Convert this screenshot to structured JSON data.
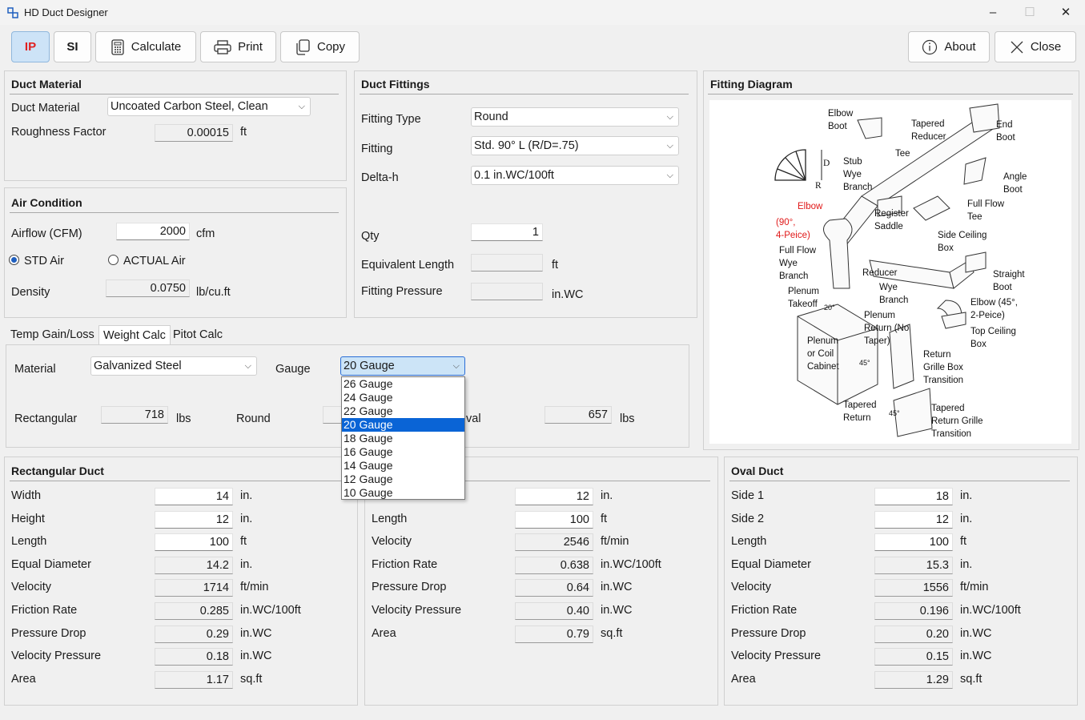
{
  "window": {
    "title": "HD Duct Designer",
    "min": "–",
    "max": "☐",
    "close": "✕"
  },
  "toolbar": {
    "ip": "IP",
    "si": "SI",
    "calculate": "Calculate",
    "print": "Print",
    "copy": "Copy",
    "about": "About",
    "close": "Close"
  },
  "duct_material": {
    "title": "Duct Material",
    "material_label": "Duct Material",
    "material_value": "Uncoated Carbon Steel, Clean",
    "roughness_label": "Roughness Factor",
    "roughness_value": "0.00015",
    "roughness_unit": "ft"
  },
  "air": {
    "title": "Air Condition",
    "airflow_label": "Airflow (CFM)",
    "airflow_value": "2000",
    "airflow_unit": "cfm",
    "std_label": "STD Air",
    "actual_label": "ACTUAL Air",
    "std_selected": true,
    "density_label": "Density",
    "density_value": "0.0750",
    "density_unit": "lb/cu.ft"
  },
  "fittings": {
    "title": "Duct Fittings",
    "type_label": "Fitting Type",
    "type_value": "Round",
    "fitting_label": "Fitting",
    "fitting_value": "Std. 90° L (R/D=.75)",
    "deltah_label": "Delta-h",
    "deltah_value": "0.1 in.WC/100ft",
    "qty_label": "Qty",
    "qty_value": "1",
    "eqlen_label": "Equivalent Length",
    "eqlen_value": "",
    "eqlen_unit": "ft",
    "press_label": "Fitting Pressure",
    "press_value": "",
    "press_unit": "in.WC"
  },
  "tabs": [
    "Temp Gain/Loss",
    "Weight Calc",
    "Pitot Calc"
  ],
  "active_tab": 1,
  "weight": {
    "material_label": "Material",
    "material_value": "Galvanized Steel",
    "gauge_label": "Gauge",
    "gauge_value": "20 Gauge",
    "gauge_options": [
      "26 Gauge",
      "24 Gauge",
      "22 Gauge",
      "20 Gauge",
      "18 Gauge",
      "16 Gauge",
      "14 Gauge",
      "12 Gauge",
      "10 Gauge"
    ],
    "gauge_selected_index": 3,
    "rect_label": "Rectangular",
    "rect_value": "718",
    "rect_unit": "lbs",
    "round_label": "Round",
    "oval_label": "Oval",
    "oval_label_visible": "val",
    "oval_value": "657",
    "oval_unit": "lbs"
  },
  "diagram": {
    "title": "Fitting Diagram",
    "labels": {
      "elbow_boot": [
        "Elbow",
        "Boot"
      ],
      "tapered_reducer": [
        "Tapered",
        "Reducer"
      ],
      "end_boot": [
        "End",
        "Boot"
      ],
      "tee": "Tee",
      "stub_wye": [
        "Stub",
        "Wye",
        "Branch"
      ],
      "angle_boot": [
        "Angle",
        "Boot"
      ],
      "elbow": "Elbow",
      "elbow_sub": [
        "(90°,",
        "4-Peice)"
      ],
      "full_flow_tee": [
        "Full Flow",
        "Tee"
      ],
      "register_saddle": [
        "Register",
        "Saddle"
      ],
      "side_ceiling_box": [
        "Side Ceiling",
        "Box"
      ],
      "full_flow_wye": [
        "Full Flow",
        "Wye",
        "Branch"
      ],
      "reducer_wye": [
        "Reducer",
        "Wye",
        "Branch"
      ],
      "straight_boot": [
        "Straight",
        "Boot"
      ],
      "plenum_takeoff": [
        "Plenum",
        "Takeoff"
      ],
      "elbow45": [
        "Elbow (45°,",
        "2-Peice)"
      ],
      "plenum_return": [
        "Plenum",
        "Return (No",
        "Taper)"
      ],
      "top_ceiling_box": [
        "Top Ceiling",
        "Box"
      ],
      "plenum_coil": [
        "Plenum",
        "or Coil",
        "Cabinet"
      ],
      "return_grille": [
        "Return",
        "Grille Box",
        "Transition"
      ],
      "tapered_return": [
        "Tapered",
        "Return"
      ],
      "tapered_return_grille": [
        "Tapered",
        "Return Grille",
        "Transition"
      ],
      "d": "D",
      "r": "R",
      "a20": "20°",
      "a45": "45°",
      "a45b": "45°"
    }
  },
  "rect": {
    "title": "Rectangular Duct",
    "rows": [
      {
        "label": "Width",
        "value": "14",
        "unit": "in.",
        "ro": false
      },
      {
        "label": "Height",
        "value": "12",
        "unit": "in.",
        "ro": false
      },
      {
        "label": "Length",
        "value": "100",
        "unit": "ft",
        "ro": false
      },
      {
        "label": "Equal Diameter",
        "value": "14.2",
        "unit": "in.",
        "ro": true
      },
      {
        "label": "Velocity",
        "value": "1714",
        "unit": "ft/min",
        "ro": true
      },
      {
        "label": "Friction Rate",
        "value": "0.285",
        "unit": "in.WC/100ft",
        "ro": true
      },
      {
        "label": "Pressure Drop",
        "value": "0.29",
        "unit": "in.WC",
        "ro": true
      },
      {
        "label": "Velocity Pressure",
        "value": "0.18",
        "unit": "in.WC",
        "ro": true
      },
      {
        "label": "Area",
        "value": "1.17",
        "unit": "sq.ft",
        "ro": true
      }
    ]
  },
  "round": {
    "rows": [
      {
        "label": "",
        "value": "12",
        "unit": "in.",
        "ro": false
      },
      {
        "label": "Length",
        "value": "100",
        "unit": "ft",
        "ro": false
      },
      {
        "label": "Velocity",
        "value": "2546",
        "unit": "ft/min",
        "ro": true
      },
      {
        "label": "Friction Rate",
        "value": "0.638",
        "unit": "in.WC/100ft",
        "ro": true
      },
      {
        "label": "Pressure Drop",
        "value": "0.64",
        "unit": "in.WC",
        "ro": true
      },
      {
        "label": "Velocity Pressure",
        "value": "0.40",
        "unit": "in.WC",
        "ro": true
      },
      {
        "label": "Area",
        "value": "0.79",
        "unit": "sq.ft",
        "ro": true
      }
    ]
  },
  "oval": {
    "title": "Oval Duct",
    "rows": [
      {
        "label": "Side 1",
        "value": "18",
        "unit": "in.",
        "ro": false
      },
      {
        "label": "Side 2",
        "value": "12",
        "unit": "in.",
        "ro": false
      },
      {
        "label": "Length",
        "value": "100",
        "unit": "ft",
        "ro": false
      },
      {
        "label": "Equal Diameter",
        "value": "15.3",
        "unit": "in.",
        "ro": true
      },
      {
        "label": "Velocity",
        "value": "1556",
        "unit": "ft/min",
        "ro": true
      },
      {
        "label": "Friction Rate",
        "value": "0.196",
        "unit": "in.WC/100ft",
        "ro": true
      },
      {
        "label": "Pressure Drop",
        "value": "0.20",
        "unit": "in.WC",
        "ro": true
      },
      {
        "label": "Velocity Pressure",
        "value": "0.15",
        "unit": "in.WC",
        "ro": true
      },
      {
        "label": "Area",
        "value": "1.29",
        "unit": "sq.ft",
        "ro": true
      }
    ]
  }
}
